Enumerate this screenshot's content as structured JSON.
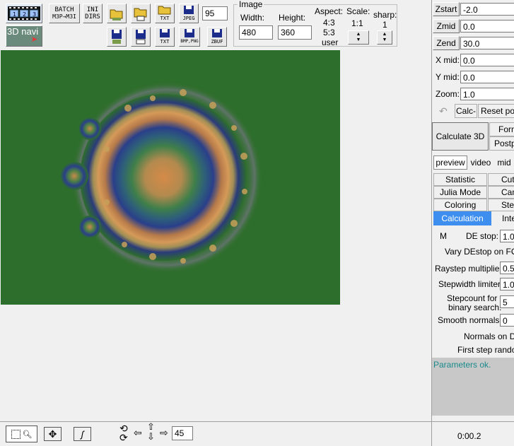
{
  "toolbar": {
    "batch_label_1": "BATCH",
    "batch_label_2": "M3P→M3I",
    "ini_label_1": "INI",
    "ini_label_2": "DIRS",
    "navi_label": "3D navi",
    "txt_label": "TXT",
    "jpeg_label": "JPEG",
    "bmp_png_label": "BMP,PNG",
    "zbuf_label": "ZBUF",
    "jpeg_quality": "95"
  },
  "image_group": {
    "title": "Image",
    "width_label": "Width:",
    "height_label": "Height:",
    "width": "480",
    "height": "360",
    "aspect_label": "Aspect:",
    "aspects": [
      "4:3",
      "5:3",
      "user"
    ],
    "scale_label": "Scale:",
    "scale": "1:1",
    "sharp_label": "sharp:",
    "sharp": "1"
  },
  "right_panel": {
    "zstart_label": "Zstart",
    "zstart": "-2.0",
    "zmid_label": "Zmid",
    "zmid": "0.0",
    "zend_label": "Zend",
    "zend": "30.0",
    "xmid_label": "X mid:",
    "xmid": "0.0",
    "ymid_label": "Y mid:",
    "ymid": "0.0",
    "zoom_label": "Zoom:",
    "zoom": "1.0",
    "calc_label": "Calc-",
    "reset_label": "Reset pos",
    "calculate3d_label": "Calculate 3D",
    "formulas_label": "Form",
    "postprocess_label": "Postpr",
    "preview_tabs": [
      "preview",
      "video",
      "mid"
    ],
    "tabs_row1": [
      "Statistic",
      "Cutt"
    ],
    "tabs_row2": [
      "Julia Mode",
      "Cam"
    ],
    "tabs_row3": [
      "Coloring",
      "Ste"
    ],
    "tabs_row4": [
      "Calculation",
      "Inte"
    ],
    "m_label": "M",
    "destop_label": "DE stop:",
    "destop": "1.0",
    "vary_destop_label": "Vary DEstop on FOV",
    "raystep_label": "Raystep multiplier:",
    "raystep": "0.5",
    "stepwidth_label": "Stepwidth limiter:",
    "stepwidth": "1.0",
    "stepcount_label_1": "Stepcount for",
    "stepcount_label_2": "binary search:",
    "stepcount": "5",
    "smooth_label": "Smooth  normals:",
    "smooth": "0",
    "normals_de_label": "Normals on DE",
    "first_step_label": "First step random",
    "status_message": "Parameters ok.",
    "timer": "0:00.2"
  },
  "bottom_bar": {
    "rotation_value": "45"
  },
  "colors": {
    "render_bg": "#2e6e2c",
    "active_tab": "#3e8ef0",
    "status_text": "#1a8a8a"
  }
}
